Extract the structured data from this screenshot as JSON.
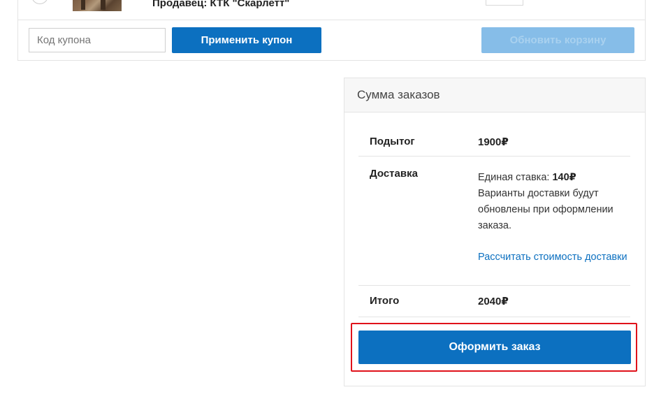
{
  "cart": {
    "seller_label": "Продавец:",
    "seller_name": "КТК \"Скарлетт\""
  },
  "coupon": {
    "placeholder": "Код купона",
    "value": "",
    "apply_label": "Применить купон"
  },
  "update_cart_label": "Обновить корзину",
  "totals": {
    "title": "Сумма заказов",
    "subtotal_label": "Подытог",
    "subtotal_value": "1900₽",
    "shipping_label": "Доставка",
    "shipping_rate_prefix": "Единая ставка:",
    "shipping_rate_value": "140₽",
    "shipping_note": "Варианты доставки будут обновлены при оформлении заказа.",
    "shipping_calc_link": "Рассчитать стоимость доставки",
    "total_label": "Итого",
    "total_value": "2040₽"
  },
  "checkout_label": "Оформить заказ",
  "colors": {
    "primary": "#0c70c0",
    "disabled": "#86bde8",
    "highlight": "#e0121a"
  }
}
